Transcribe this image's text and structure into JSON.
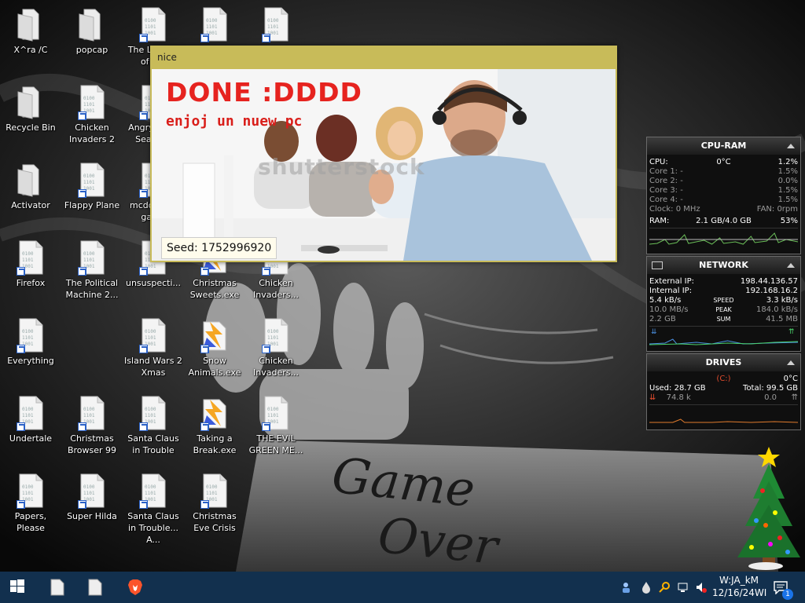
{
  "desktop_icons": [
    {
      "label": "X^ra /C",
      "type": "folder",
      "shortcut": false
    },
    {
      "label": "popcap",
      "type": "folder",
      "shortcut": false
    },
    {
      "label": "The Legend of Z...",
      "type": "file",
      "shortcut": true
    },
    {
      "label": "",
      "type": "file",
      "shortcut": true
    },
    {
      "label": "",
      "type": "file",
      "shortcut": true
    },
    {
      "label": "Recycle Bin",
      "type": "folder",
      "shortcut": false
    },
    {
      "label": "Chicken Invaders 2",
      "type": "file",
      "shortcut": true
    },
    {
      "label": "Angry Birds Seasons",
      "type": "file",
      "shortcut": true
    },
    {
      "label": "Activator",
      "type": "folder",
      "shortcut": false
    },
    {
      "label": "Flappy Plane",
      "type": "file",
      "shortcut": true
    },
    {
      "label": "mcdonalds game",
      "type": "file",
      "shortcut": true
    },
    {
      "label": "Firefox",
      "type": "file",
      "shortcut": true
    },
    {
      "label": "The Political Machine 2...",
      "type": "file",
      "shortcut": true
    },
    {
      "label": "unsuspecti...",
      "type": "file",
      "shortcut": true
    },
    {
      "label": "Christmas Sweets.exe",
      "type": "exe",
      "shortcut": true
    },
    {
      "label": "Chicken Invaders...",
      "type": "file",
      "shortcut": true
    },
    {
      "label": "Everything",
      "type": "file",
      "shortcut": true
    },
    {
      "label": "Island Wars 2 Xmas",
      "type": "file",
      "shortcut": true
    },
    {
      "label": "Snow Animals.exe",
      "type": "exe",
      "shortcut": true
    },
    {
      "label": "Chicken Invaders...",
      "type": "file",
      "shortcut": true
    },
    {
      "label": "Undertale",
      "type": "file",
      "shortcut": true
    },
    {
      "label": "Christmas Browser 99",
      "type": "file",
      "shortcut": true
    },
    {
      "label": "Santa Claus in Trouble",
      "type": "file",
      "shortcut": true
    },
    {
      "label": "Taking a Break.exe",
      "type": "exe",
      "shortcut": true
    },
    {
      "label": "THE EVIL GREEN ME...",
      "type": "file",
      "shortcut": true
    },
    {
      "label": "Papers, Please",
      "type": "file",
      "shortcut": true
    },
    {
      "label": "Super Hilda",
      "type": "file",
      "shortcut": true
    },
    {
      "label": "Santa Claus in Trouble... A...",
      "type": "file",
      "shortcut": true
    },
    {
      "label": "Christmas Eve Crisis",
      "type": "file",
      "shortcut": true
    }
  ],
  "window": {
    "title": "nice",
    "headline": "DONE :DDDD",
    "subline": "enjoj un nuew pc",
    "watermark": "shutterstock",
    "seed": "Seed: 1752996920"
  },
  "gadget": {
    "cpu": {
      "title": "CPU-RAM",
      "cpu_label": "CPU:",
      "temp": "0°C",
      "cpu_pct": "1.2%",
      "cores": [
        {
          "label": "Core 1:",
          "dash": "-",
          "pct": "1.5%"
        },
        {
          "label": "Core 2:",
          "dash": "-",
          "pct": "0.0%"
        },
        {
          "label": "Core 3:",
          "dash": "-",
          "pct": "1.5%"
        },
        {
          "label": "Core 4:",
          "dash": "-",
          "pct": "1.5%"
        }
      ],
      "clock": "Clock: 0 MHz",
      "fan": "FAN: 0rpm",
      "ram_label": "RAM:",
      "ram_value": "2.1 GB/4.0 GB",
      "ram_pct": "53%"
    },
    "network": {
      "title": "NETWORK",
      "ext_label": "External IP:",
      "ext_ip": "198.44.136.57",
      "int_label": "Internal IP:",
      "int_ip": "192.168.16.2",
      "speed_down": "5.4 kB/s",
      "speed_label": "SPEED",
      "speed_up": "3.3 kB/s",
      "peak_down": "10.0 MB/s",
      "peak_label": "PEAK",
      "peak_up": "184.0 kB/s",
      "sum_down": "2.2 GB",
      "sum_label": "SUM",
      "sum_up": "41.5 MB"
    },
    "drives": {
      "title": "DRIVES",
      "drive_letter": "(C:)",
      "temp": "0°C",
      "used": "Used: 28.7 GB",
      "total": "Total: 99.5 GB",
      "read": "74.8 k",
      "write": "0.0"
    }
  },
  "taskbar": {
    "clock_line1": "W:JA_kM",
    "clock_line2": "12/16/24WI",
    "notification_count": "1"
  },
  "colors": {
    "taskbar": "#12304e",
    "window_frame": "#c8bb59",
    "headline_red": "#e6231f"
  }
}
